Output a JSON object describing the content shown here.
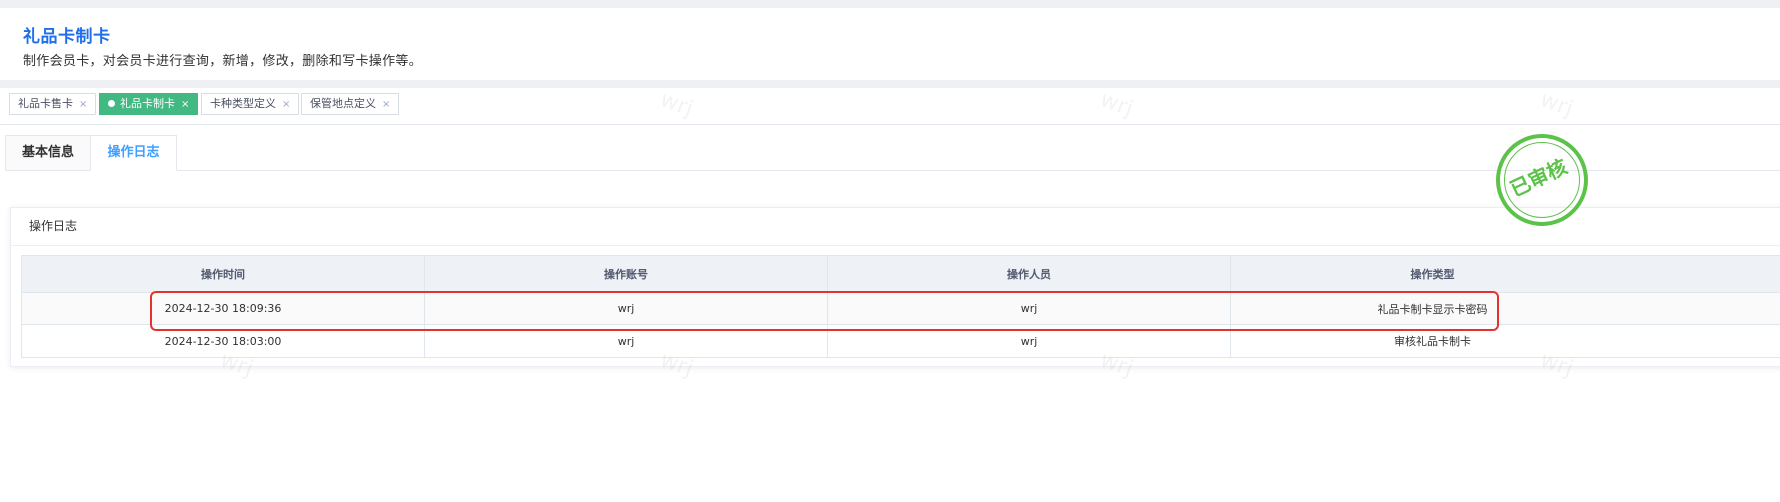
{
  "page": {
    "title": "礼品卡制卡",
    "description": "制作会员卡，对会员卡进行查询，新增，修改，删除和写卡操作等。"
  },
  "tags": [
    {
      "label": "礼品卡售卡",
      "active": false
    },
    {
      "label": "礼品卡制卡",
      "active": true
    },
    {
      "label": "卡种类型定义",
      "active": false
    },
    {
      "label": "保管地点定义",
      "active": false
    }
  ],
  "tag_close_glyph": "×",
  "tabs": [
    {
      "label": "基本信息",
      "active": false
    },
    {
      "label": "操作日志",
      "active": true
    }
  ],
  "log_card": {
    "title": "操作日志",
    "columns": [
      "操作时间",
      "操作账号",
      "操作人员",
      "操作类型"
    ],
    "rows": [
      [
        "2024-12-30 18:09:36",
        "wrj",
        "wrj",
        "礼品卡制卡显示卡密码"
      ],
      [
        "2024-12-30 18:03:00",
        "wrj",
        "wrj",
        "审核礼品卡制卡"
      ]
    ]
  },
  "stamp": {
    "text": "已审核",
    "color": "#5cc24a"
  },
  "watermark": "wrj",
  "colors": {
    "accent": "#409eff",
    "title_blue": "#1f6feb",
    "active_tag": "#42b983",
    "highlight_red": "#e5322d"
  }
}
